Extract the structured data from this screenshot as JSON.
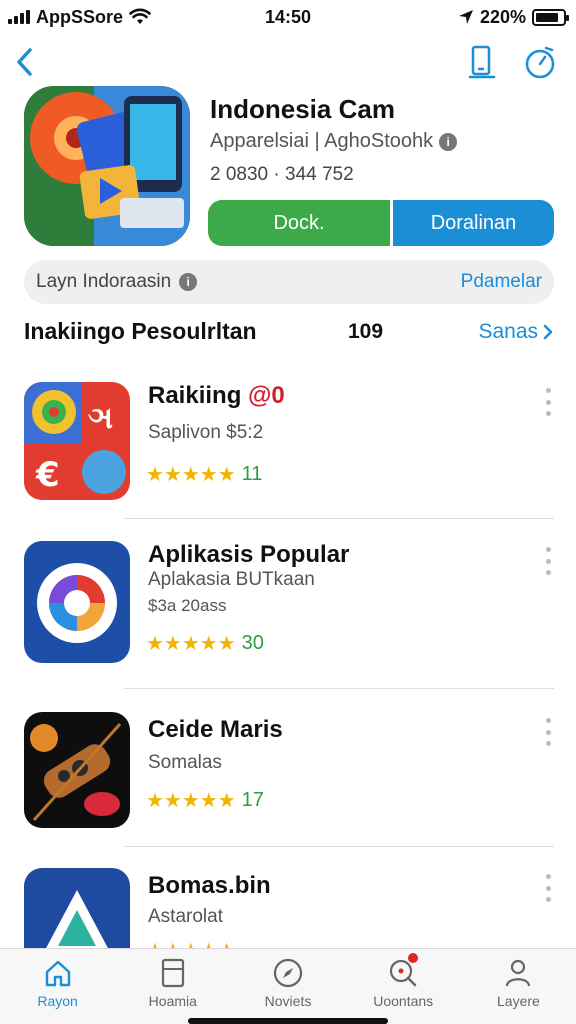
{
  "status_bar": {
    "carrier": "AppSSore",
    "time": "14:50",
    "battery_text": "220%",
    "battery_level": 0.85
  },
  "nav": {
    "back_icon": "chevron-left-icon",
    "share_icon": "phone-share-icon",
    "timer_icon": "timer-icon"
  },
  "app": {
    "title": "Indonesia Cam",
    "developer": "Apparelsiai | AghoStoohk",
    "stats": "2 0830 · 344 752",
    "button_primary": "Dock.",
    "button_secondary": "Doralinan"
  },
  "search_pill": {
    "label": "Layn Indoraasin",
    "action": "Pdamelar"
  },
  "section": {
    "title": "Inakiingo Pesoulrltan",
    "count": "109",
    "see_all": "Sanas"
  },
  "list": [
    {
      "name": "Raikiing",
      "badge": "@0",
      "subtitle": "Saplivon $5:2",
      "extra": "",
      "rating_stars": 5,
      "rating_count": "11"
    },
    {
      "name": "Aplikasis Popular",
      "badge": "",
      "subtitle": "Aplakasia BUTkaan",
      "extra": "$3a 20ass",
      "rating_stars": 5,
      "rating_count": "30"
    },
    {
      "name": "Ceide Maris",
      "badge": "",
      "subtitle": "Somalas",
      "extra": "",
      "rating_stars": 5,
      "rating_count": "17"
    },
    {
      "name": "Bomas.bin",
      "badge": "",
      "subtitle": "Astarolat",
      "extra": "",
      "rating_stars": 5,
      "rating_count": ""
    }
  ],
  "tabs": [
    {
      "label": "Rayon",
      "icon": "home-icon",
      "active": true
    },
    {
      "label": "Hoamia",
      "icon": "tablet-icon",
      "active": false
    },
    {
      "label": "Noviets",
      "icon": "compass-icon",
      "active": false
    },
    {
      "label": "Uoontans",
      "icon": "search-icon",
      "active": false
    },
    {
      "label": "Layere",
      "icon": "person-icon",
      "active": false
    }
  ],
  "colors": {
    "accent_blue": "#1a8fd6",
    "green": "#3daa4a",
    "star": "#f2b400",
    "badge_red": "#d0202e"
  }
}
